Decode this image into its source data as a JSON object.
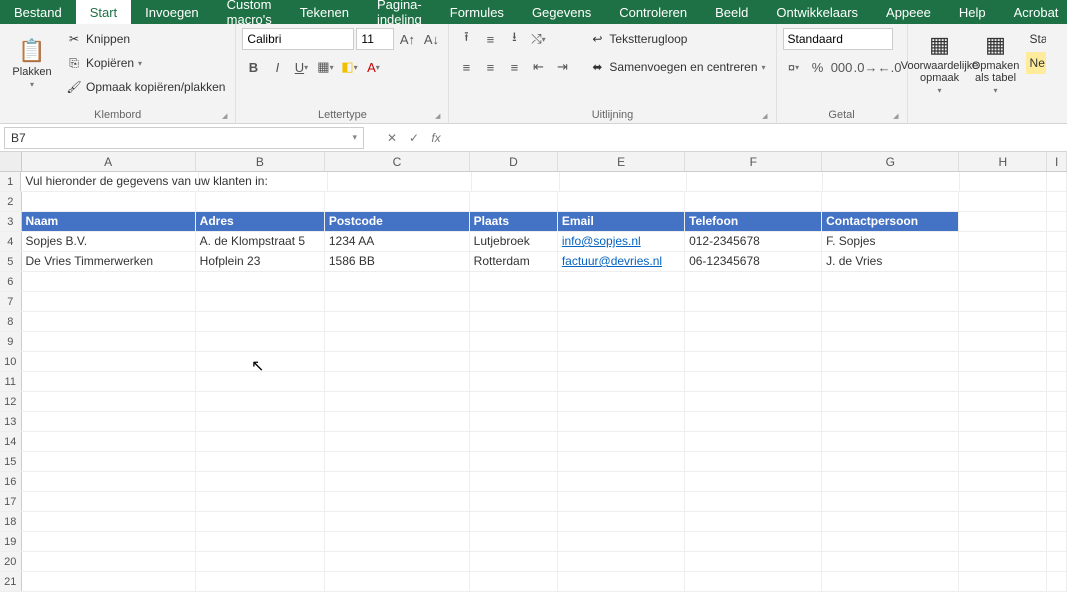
{
  "tabs": {
    "file": "Bestand",
    "start": "Start",
    "insert": "Invoegen",
    "custom": "Custom macro's",
    "draw": "Tekenen",
    "layout": "Pagina-indeling",
    "formulas": "Formules",
    "data": "Gegevens",
    "review": "Controleren",
    "view": "Beeld",
    "developer": "Ontwikkelaars",
    "appeee": "Appeee",
    "help": "Help",
    "acrobat": "Acrobat"
  },
  "ribbon": {
    "paste": "Plakken",
    "cut": "Knippen",
    "copy": "Kopiëren",
    "format_painter": "Opmaak kopiëren/plakken",
    "clipboard_group": "Klembord",
    "font_name": "Calibri",
    "font_size": "11",
    "font_group": "Lettertype",
    "wrap": "Tekstterugloop",
    "merge": "Samenvoegen en centreren",
    "align_group": "Uitlijning",
    "num_format": "Standaard",
    "num_group": "Getal",
    "cond_fmt": "Voorwaardelijke opmaak",
    "as_table": "Opmaken als tabel",
    "styles_btn": "Sta",
    "neutral": "Ne"
  },
  "namebox": "B7",
  "fx": "fx",
  "columns": [
    "A",
    "B",
    "C",
    "D",
    "E",
    "F",
    "G",
    "H",
    "I"
  ],
  "row1": "Vul hieronder de gegevens van uw klanten in:",
  "headers": {
    "naam": "Naam",
    "adres": "Adres",
    "postcode": "Postcode",
    "plaats": "Plaats",
    "email": "Email",
    "telefoon": "Telefoon",
    "contact": "Contactpersoon"
  },
  "rows": [
    {
      "naam": "Sopjes B.V.",
      "adres": "A. de Klompstraat 5",
      "postcode": "1234 AA",
      "plaats": "Lutjebroek",
      "email": "info@sopjes.nl",
      "telefoon": "012-2345678",
      "contact": "F. Sopjes"
    },
    {
      "naam": "De Vries Timmerwerken",
      "adres": "Hofplein 23",
      "postcode": "1586 BB",
      "plaats": "Rotterdam",
      "email": "factuur@devries.nl",
      "telefoon": "06-12345678",
      "contact": "J. de Vries"
    }
  ]
}
